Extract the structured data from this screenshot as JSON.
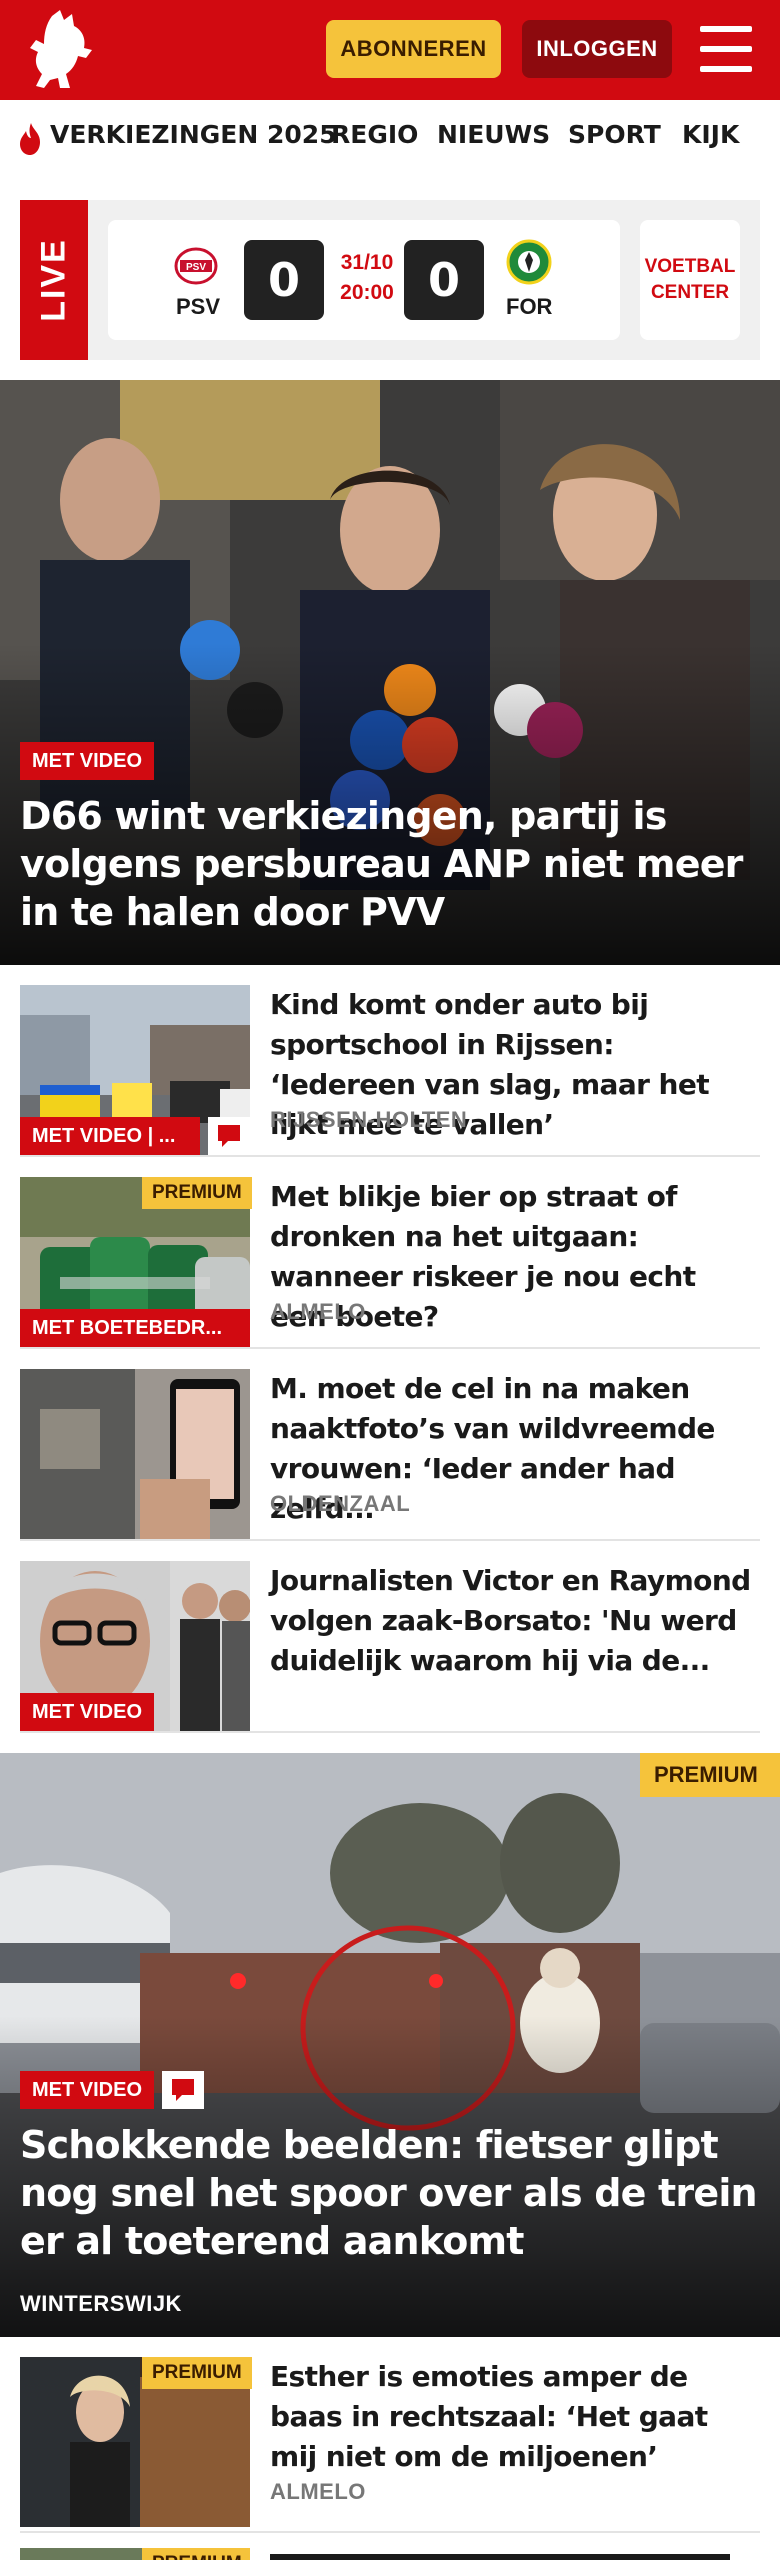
{
  "header": {
    "logo_icon": "tubantia-horse-logo",
    "subscribe_label": "ABONNEREN",
    "login_label": "INLOGGEN",
    "menu_icon": "hamburger-menu-icon",
    "brand_color": "#d10a11"
  },
  "nav": {
    "items": [
      {
        "label": "VERKIEZINGEN 2025",
        "icon": "flame-icon"
      },
      {
        "label": "REGIO"
      },
      {
        "label": "NIEUWS"
      },
      {
        "label": "SPORT"
      },
      {
        "label": "KIJK"
      }
    ]
  },
  "live": {
    "label": "LIVE",
    "home_team": "PSV",
    "away_team": "FOR",
    "home_score": "0",
    "away_score": "0",
    "date": "31/10",
    "time": "20:00",
    "voetbal_center": "VOETBAL CENTER"
  },
  "hero": {
    "badge": "MET VIDEO",
    "title": "D66 wint verkiezingen, partij is volgens persbureau ANP niet meer in te halen door PVV"
  },
  "articles": [
    {
      "title": "Kind komt onder auto bij sportschool in Rijssen: ‘Iedereen van slag, maar het lijkt mee te vallen’",
      "location": "RIJSSEN-HOLTEN",
      "badge": "MET VIDEO | ...",
      "has_comments": true
    },
    {
      "title": "Met blikje bier op straat of dronken na het uitgaan: wanneer riskeer je nou echt een boete?",
      "location": "ALMELO",
      "badge": "MET BOETEBEDR...",
      "premium": "PREMIUM"
    },
    {
      "title": "M. moet de cel in na maken naaktfoto’s van wildvreemde vrouwen: ‘Ieder ander had zelfd...",
      "location": "OLDENZAAL"
    },
    {
      "title": "Journalisten Victor en Raymond volgen zaak-Borsato: 'Nu werd duidelijk waarom hij via de...",
      "badge": "MET VIDEO"
    }
  ],
  "big_article": {
    "premium": "PREMIUM",
    "badge": "MET VIDEO",
    "title": "Schokkende beelden: fietser glipt nog snel het spoor over als de trein er al toeterend aankomt",
    "location": "WINTERSWIJK"
  },
  "article_after": {
    "title": "Esther is emoties amper de baas in rechtszaal: ‘Het gaat mij niet om de miljoenen’",
    "location": "ALMELO",
    "premium": "PREMIUM"
  },
  "article_partial": {
    "premium": "PREMIUM"
  }
}
